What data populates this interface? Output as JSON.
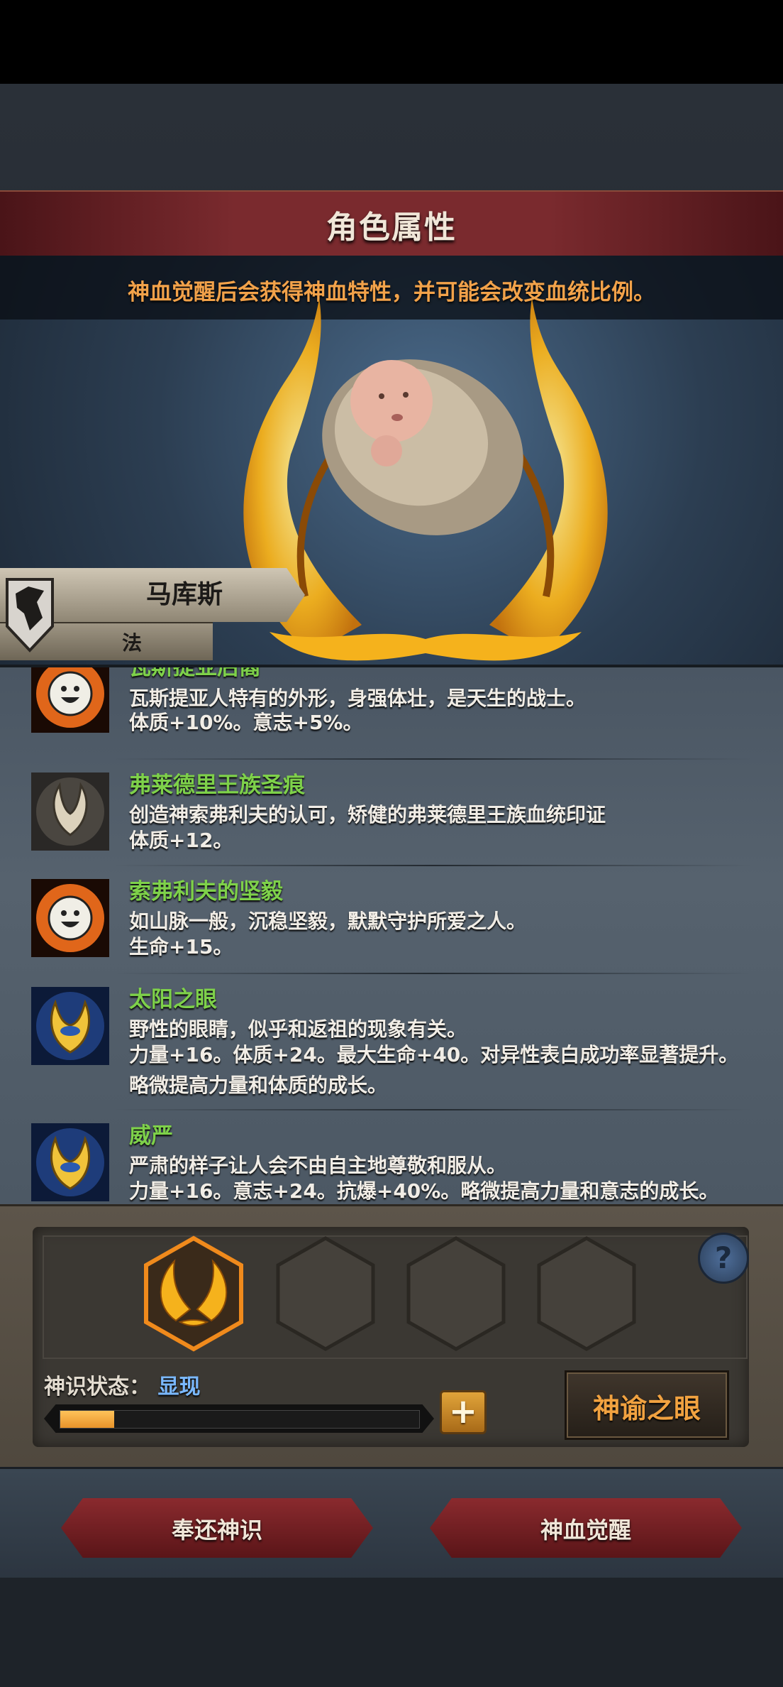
{
  "header": {
    "title": "角色属性"
  },
  "hero": {
    "notice": "神血觉醒后会获得神血特性，并可能会改变血统比例。",
    "name": "马库斯",
    "class": "法"
  },
  "traits": [
    {
      "name": "瓦斯提亚后裔",
      "icon": "smiley-face-icon",
      "desc": "瓦斯提亚人特有的外形，身强体壮，是天生的战士。",
      "stats": "体质+10%。意志+5%。"
    },
    {
      "name": "弗莱德里王族圣痕",
      "icon": "pale-horns-icon",
      "desc": "创造神索弗利夫的认可，矫健的弗莱德里王族血统印证",
      "stats": "体质+12。"
    },
    {
      "name": "索弗利夫的坚毅",
      "icon": "smiley-face-icon",
      "desc": "如山脉一般，沉稳坚毅，默默守护所爱之人。",
      "stats": "生命+15。"
    },
    {
      "name": "太阳之眼",
      "icon": "golden-eye-crest-icon",
      "desc": "野性的眼睛，似乎和返祖的现象有关。",
      "stats": "力量+16。体质+24。最大生命+40。对异性表白成功率显著提升。略微提高力量和体质的成长。"
    },
    {
      "name": "威严",
      "icon": "golden-eye-crest-icon",
      "desc": "严肃的样子让人会不由自主地尊敬和服从。",
      "stats": "力量+16。意志+24。抗爆+40%。略微提高力量和意志的成长。"
    }
  ],
  "divine": {
    "status_label": "神识状态：",
    "status_value": "显现",
    "progress": 0.15,
    "oracle_button": "神谕之眼",
    "plus_label": "+",
    "help_label": "?"
  },
  "buttons": {
    "return": "奉还神识",
    "awaken": "神血觉醒"
  },
  "colors": {
    "accent_orange": "#f2a24a",
    "trait_green": "#7ed14a",
    "status_blue": "#7ab8ff",
    "banner_red": "#7a2a2e"
  }
}
